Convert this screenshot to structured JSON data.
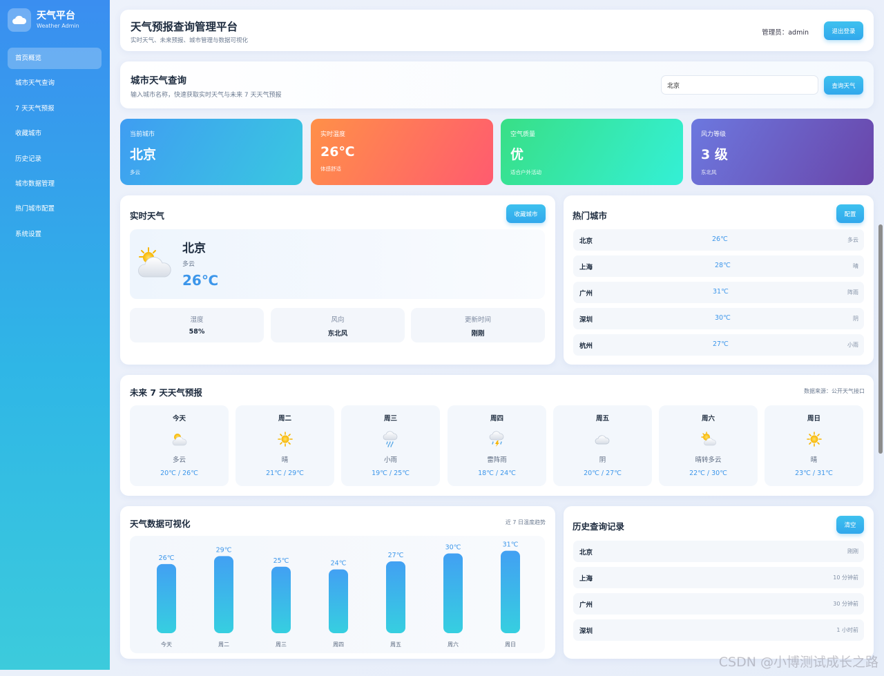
{
  "sidebar": {
    "title": "天气平台",
    "subtitle": "Weather Admin",
    "items": [
      {
        "label": "首页概览",
        "active": true
      },
      {
        "label": "城市天气查询"
      },
      {
        "label": "7 天天气预报"
      },
      {
        "label": "收藏城市"
      },
      {
        "label": "历史记录"
      },
      {
        "label": "城市数据管理"
      },
      {
        "label": "热门城市配置"
      },
      {
        "label": "系统设置"
      }
    ]
  },
  "header": {
    "title": "天气预报查询管理平台",
    "subtitle": "实时天气、未来预报、城市管理与数据可视化",
    "admin_label": "管理员：admin",
    "logout_label": "退出登录"
  },
  "search": {
    "title": "城市天气查询",
    "subtitle": "输入城市名称，快速获取实时天气与未来 7 天天气预报",
    "value": "北京",
    "button_label": "查询天气"
  },
  "stats": [
    {
      "label": "当前城市",
      "value": "北京",
      "note": "多云"
    },
    {
      "label": "实时温度",
      "value": "26℃",
      "note": "体感舒适"
    },
    {
      "label": "空气质量",
      "value": "优",
      "note": "适合户外活动"
    },
    {
      "label": "风力等级",
      "value": "3 级",
      "note": "东北风"
    }
  ],
  "realtime": {
    "title": "实时天气",
    "favorite_label": "收藏城市",
    "city": "北京",
    "condition": "多云",
    "temp": "26℃",
    "icon": "partly-cloudy-icon",
    "metrics": [
      {
        "label": "湿度",
        "value": "58%"
      },
      {
        "label": "风向",
        "value": "东北风"
      },
      {
        "label": "更新时间",
        "value": "刚刚"
      }
    ]
  },
  "hot_cities": {
    "title": "热门城市",
    "config_label": "配置",
    "rows": [
      {
        "city": "北京",
        "temp": "26℃",
        "condition": "多云"
      },
      {
        "city": "上海",
        "temp": "28℃",
        "condition": "晴"
      },
      {
        "city": "广州",
        "temp": "31℃",
        "condition": "阵雨"
      },
      {
        "city": "深圳",
        "temp": "30℃",
        "condition": "阴"
      },
      {
        "city": "杭州",
        "temp": "27℃",
        "condition": "小雨"
      }
    ]
  },
  "forecast": {
    "title": "未来 7 天天气预报",
    "source": "数据来源：公开天气接口",
    "days": [
      {
        "name": "今天",
        "icon": "partly-cloudy-icon",
        "condition": "多云",
        "range": "20℃ / 26℃"
      },
      {
        "name": "周二",
        "icon": "sun-icon",
        "condition": "晴",
        "range": "21℃ / 29℃"
      },
      {
        "name": "周三",
        "icon": "rain-icon",
        "condition": "小雨",
        "range": "19℃ / 25℃"
      },
      {
        "name": "周四",
        "icon": "thunderstorm-icon",
        "condition": "雷阵雨",
        "range": "18℃ / 24℃"
      },
      {
        "name": "周五",
        "icon": "cloud-icon",
        "condition": "阴",
        "range": "20℃ / 27℃"
      },
      {
        "name": "周六",
        "icon": "sun-cloud-icon",
        "condition": "晴转多云",
        "range": "22℃ / 30℃"
      },
      {
        "name": "周日",
        "icon": "sun-icon",
        "condition": "晴",
        "range": "23℃ / 31℃"
      }
    ]
  },
  "viz": {
    "title": "天气数据可视化",
    "note": "近 7 日温度趋势"
  },
  "chart_data": {
    "type": "bar",
    "categories": [
      "今天",
      "周二",
      "周三",
      "周四",
      "周五",
      "周六",
      "周日"
    ],
    "values": [
      26,
      29,
      25,
      24,
      27,
      30,
      31
    ],
    "data_labels": [
      "26℃",
      "29℃",
      "25℃",
      "24℃",
      "27℃",
      "30℃",
      "31℃"
    ],
    "title": "",
    "xlabel": "",
    "ylabel": "",
    "grid": false,
    "colors": {
      "bar_top": "#42a0f3",
      "bar_bottom": "#36cfe0",
      "label": "#3c96ea"
    }
  },
  "history": {
    "title": "历史查询记录",
    "clear_label": "清空",
    "rows": [
      {
        "city": "北京",
        "time": "刚刚"
      },
      {
        "city": "上海",
        "time": "10 分钟前"
      },
      {
        "city": "广州",
        "time": "30 分钟前"
      },
      {
        "city": "深圳",
        "time": "1 小时前"
      }
    ]
  },
  "watermark": "CSDN @小博测试成长之路",
  "colors": {
    "accent": "#31a8ec",
    "temp_blue": "#3c96ea",
    "sidebar_top": "#3a8ef0",
    "sidebar_bottom": "#3ccbdc"
  }
}
